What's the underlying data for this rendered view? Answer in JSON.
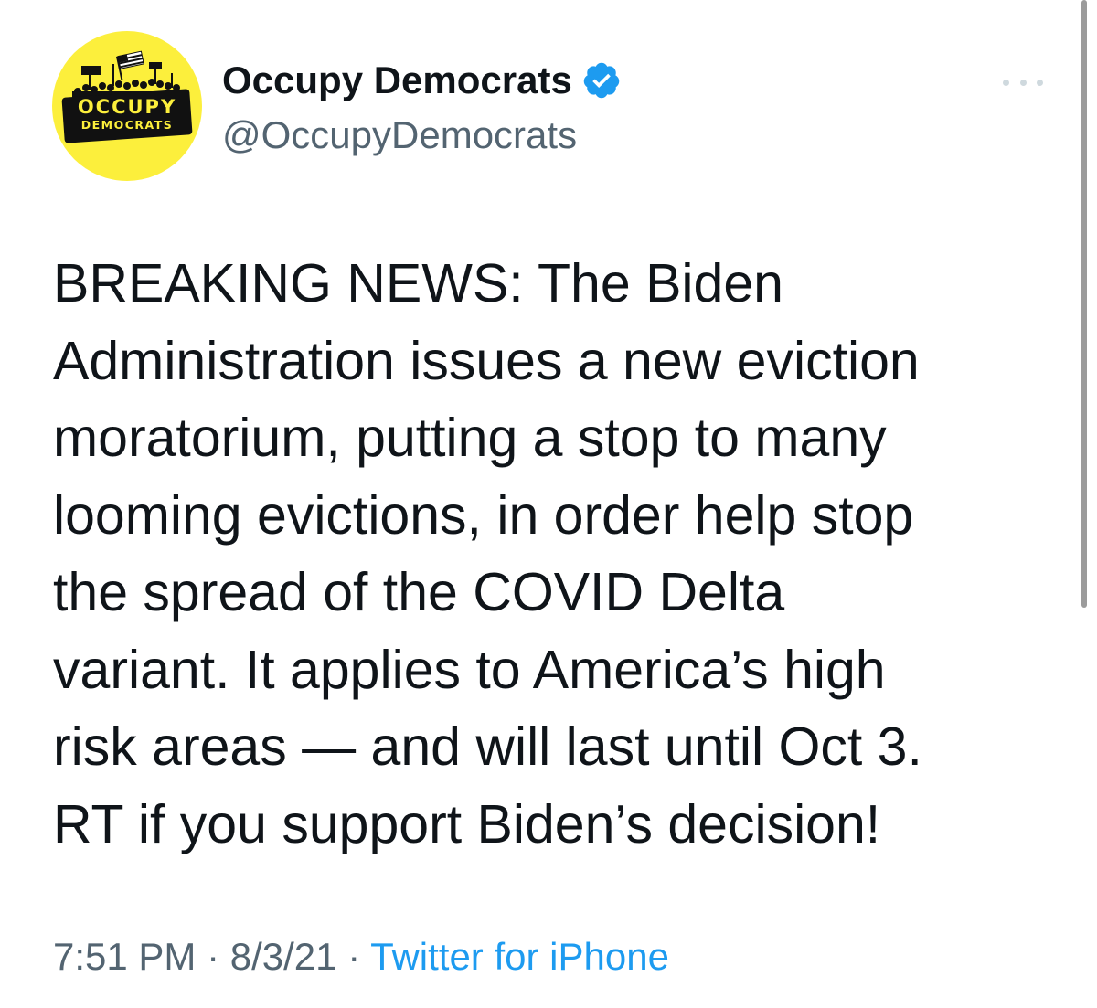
{
  "account": {
    "display_name": "Occupy Democrats",
    "handle": "@OccupyDemocrats",
    "avatar_logo": {
      "line1": "OCCUPY",
      "line2": "DEMOCRATS"
    },
    "avatar_color": "#fcef3c",
    "verified_color": "#1d9bf0"
  },
  "tweet": {
    "lines": [
      "BREAKING NEWS: The Biden",
      "Administration issues a new eviction",
      "moratorium, putting a stop to many",
      "looming evictions, in order help stop",
      "the spread of the COVID Delta",
      "variant. It applies to America’s high",
      "risk areas — and will last until Oct 3.",
      "RT if you support Biden’s decision!"
    ]
  },
  "meta": {
    "time": "7:51 PM",
    "date": "8/3/21",
    "separator": " · ",
    "source": "Twitter for iPhone"
  },
  "icons": {
    "verified": "verified-badge-icon",
    "more": "more-options-icon"
  }
}
